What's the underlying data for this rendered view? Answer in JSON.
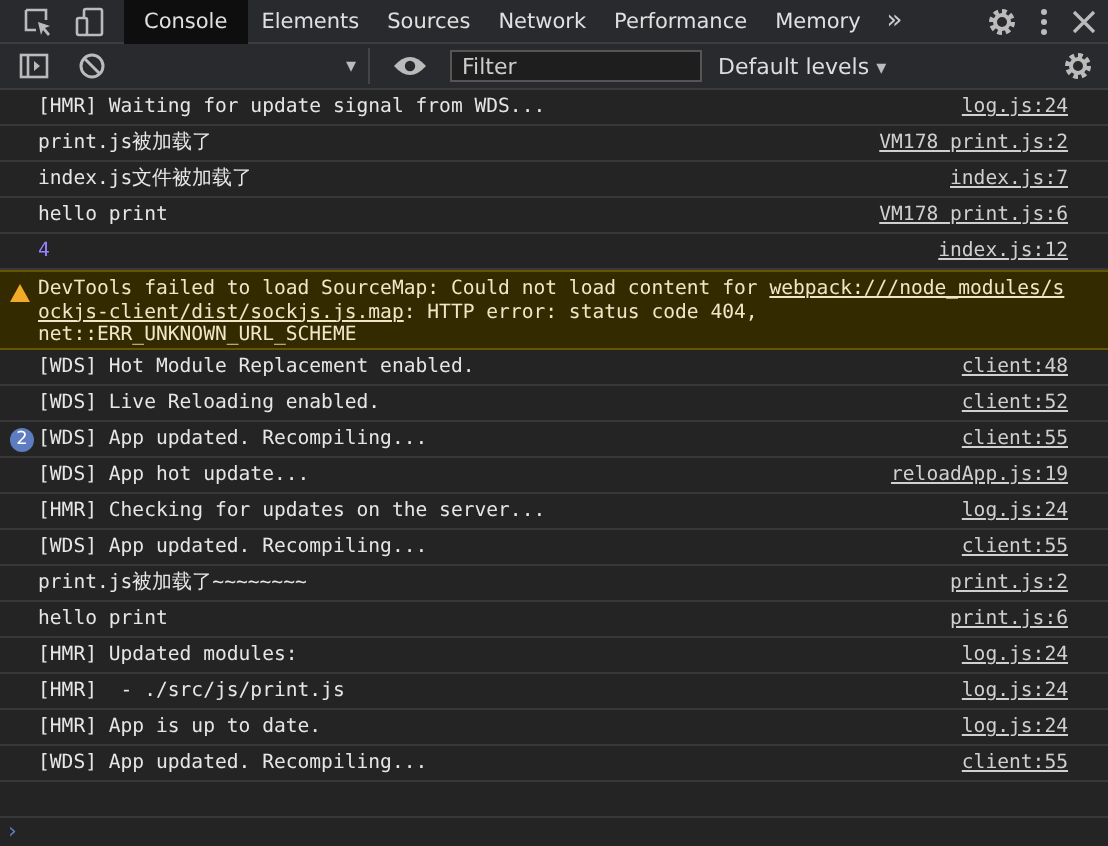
{
  "tabs": [
    {
      "label": "Console",
      "selected": true
    },
    {
      "label": "Elements",
      "selected": false
    },
    {
      "label": "Sources",
      "selected": false
    },
    {
      "label": "Network",
      "selected": false
    },
    {
      "label": "Performance",
      "selected": false
    },
    {
      "label": "Memory",
      "selected": false
    }
  ],
  "more_tabs": "»",
  "toolbar": {
    "context_caret": "▾",
    "filter": {
      "placeholder": "Filter"
    },
    "levels": "Default levels",
    "levels_caret": "▾"
  },
  "messages": [
    {
      "kind": "log",
      "text": "[HMR] Waiting for update signal from WDS...",
      "source": "log.js:24"
    },
    {
      "kind": "log",
      "text": "print.js被加载了",
      "source": "VM178 print.js:2"
    },
    {
      "kind": "log",
      "text": "index.js文件被加载了",
      "source": "index.js:7"
    },
    {
      "kind": "log",
      "text": "hello print",
      "source": "VM178 print.js:6"
    },
    {
      "kind": "number",
      "text": "4",
      "source": "index.js:12"
    },
    {
      "kind": "warning",
      "lines": [
        [
          {
            "text": "DevTools failed to load SourceMap: Could not load content for "
          },
          {
            "text": "webpack:///node_modules/s",
            "link": true
          }
        ],
        [
          {
            "text": "ockjs-client/dist/sockjs.js.map",
            "link": true
          },
          {
            "text": ": HTTP error: status code 404,"
          }
        ],
        [
          {
            "text": "net::ERR_UNKNOWN_URL_SCHEME"
          }
        ]
      ]
    },
    {
      "kind": "log",
      "text": "[WDS] Hot Module Replacement enabled.",
      "source": "client:48"
    },
    {
      "kind": "log",
      "text": "[WDS] Live Reloading enabled.",
      "source": "client:52"
    },
    {
      "kind": "log",
      "text": "[WDS] App updated. Recompiling...",
      "source": "client:55",
      "count": "2"
    },
    {
      "kind": "log",
      "text": "[WDS] App hot update...",
      "source": "reloadApp.js:19"
    },
    {
      "kind": "log",
      "text": "[HMR] Checking for updates on the server...",
      "source": "log.js:24"
    },
    {
      "kind": "log",
      "text": "[WDS] App updated. Recompiling...",
      "source": "client:55"
    },
    {
      "kind": "log",
      "text": "print.js被加载了~~~~~~~~",
      "source": "print.js:2"
    },
    {
      "kind": "log",
      "text": "hello print",
      "source": "print.js:6"
    },
    {
      "kind": "log",
      "text": "[HMR] Updated modules:",
      "source": "log.js:24"
    },
    {
      "kind": "log",
      "text": "[HMR]  - ./src/js/print.js",
      "source": "log.js:24"
    },
    {
      "kind": "log",
      "text": "[HMR] App is up to date.",
      "source": "log.js:24"
    },
    {
      "kind": "log",
      "text": "[WDS] App updated. Recompiling...",
      "source": "client:55"
    },
    {
      "kind": "empty"
    }
  ],
  "prompt": "›"
}
